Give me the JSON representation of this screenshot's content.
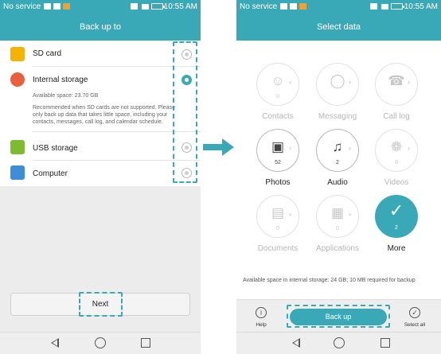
{
  "left_phone": {
    "status": {
      "carrier": "No service",
      "time": "10:55 AM"
    },
    "title": "Back up to",
    "options": [
      {
        "label": "SD card",
        "icon": "sd-card-icon",
        "selected": false
      },
      {
        "label": "Internal storage",
        "icon": "internal-storage-icon",
        "selected": true,
        "available_space": "Available space: 23.70 GB",
        "note": [
          "Recommended when SD cards are not supported. Please",
          "only back up data that takes little space, including your",
          "contacts, messages, call log, and calendar schedule."
        ]
      },
      {
        "label": "USB storage",
        "icon": "usb-icon",
        "selected": false
      },
      {
        "label": "Computer",
        "icon": "computer-icon",
        "selected": false
      }
    ],
    "next_label": "Next"
  },
  "right_phone": {
    "status": {
      "carrier": "No service",
      "time": "10:55 AM"
    },
    "title": "Select data",
    "items": [
      {
        "label": "Contacts",
        "count": "0",
        "icon": "contacts-icon",
        "state": "dim"
      },
      {
        "label": "Messaging",
        "count": "",
        "icon": "messaging-icon",
        "state": "dim"
      },
      {
        "label": "Call log",
        "count": "",
        "icon": "call-log-icon",
        "state": "dim"
      },
      {
        "label": "Photos",
        "count": "52",
        "icon": "photos-icon",
        "state": "active"
      },
      {
        "label": "Audio",
        "count": "2",
        "icon": "audio-icon",
        "state": "active"
      },
      {
        "label": "Videos",
        "count": "0",
        "icon": "videos-icon",
        "state": "dim"
      },
      {
        "label": "Documents",
        "count": "0",
        "icon": "documents-icon",
        "state": "dim"
      },
      {
        "label": "Applications",
        "count": "0",
        "icon": "applications-icon",
        "state": "dim"
      },
      {
        "label": "More",
        "count": "2",
        "icon": "check-icon",
        "state": "selected"
      }
    ],
    "storage_note": "Available space in internal storage: 24 GB; 10 MB required for backup",
    "help_label": "Help",
    "backup_label": "Back up",
    "select_all_label": "Select all"
  },
  "colors": {
    "accent": "#3aa9b7",
    "background": "#ececec"
  }
}
